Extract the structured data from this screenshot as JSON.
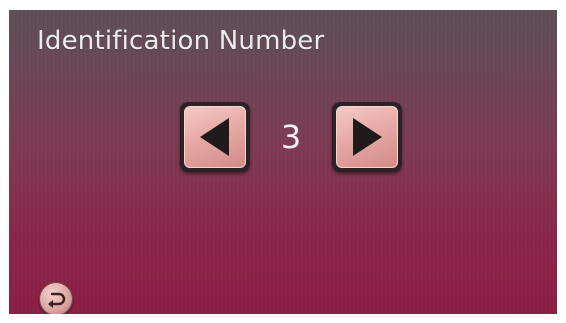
{
  "header": {
    "title": "Identification Number"
  },
  "stepper": {
    "value": "3",
    "decrement_icon": "triangle-left-icon",
    "increment_icon": "triangle-right-icon"
  },
  "footer": {
    "back_icon": "return-arrow-icon"
  },
  "colors": {
    "background_top": "#5c4f55",
    "background_bottom": "#8c1d44",
    "button_face": "#e7aaa6",
    "arrow": "#1f1a1b",
    "text": "#ececec"
  }
}
